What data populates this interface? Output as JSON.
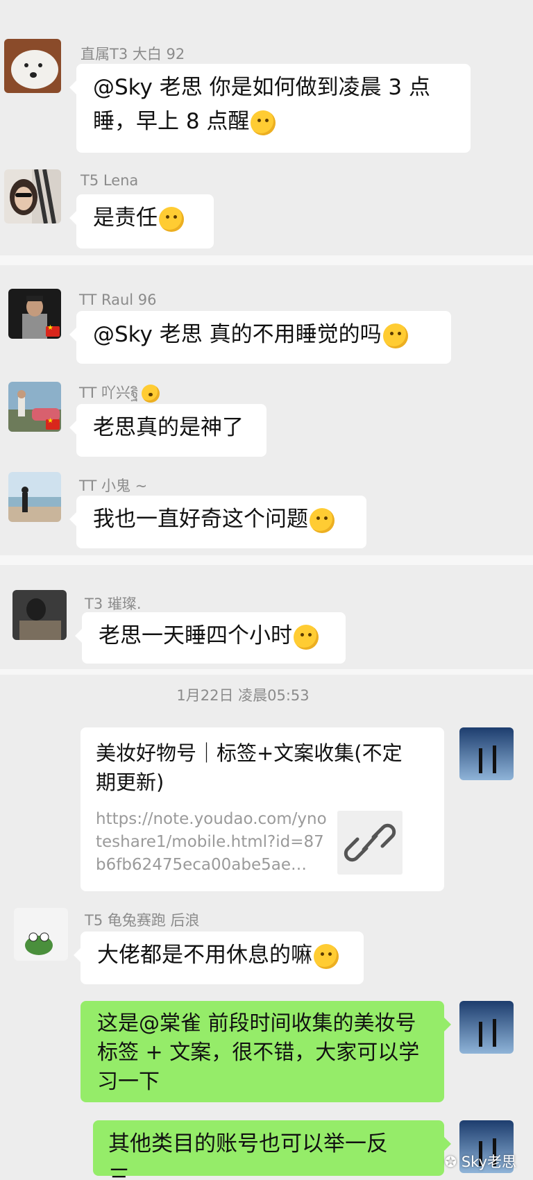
{
  "group1": {
    "msg1": {
      "sender": "直属T3 大白 92",
      "line1": "@Sky 老思  你是如何做到凌晨 3 点",
      "line2": "睡，早上 8 点醒",
      "emoji": "laughing-tears-emoji"
    },
    "msg2": {
      "sender": "T5 Lena",
      "text": "是责任",
      "emoji": "grinning-emoji"
    }
  },
  "group2": {
    "msg1": {
      "sender": "TT Raul 96",
      "text": "@Sky 老思  真的不用睡觉的吗",
      "emoji": "thinking-666-emoji"
    },
    "msg2": {
      "sender": "TT 吖兴ฐิ",
      "text": "老思真的是神了",
      "emoji": "relieved-emoji"
    },
    "msg3": {
      "sender": "TT 小鬼 ~",
      "text": "我也一直好奇这个问题",
      "emoji": "crying-emoji"
    }
  },
  "group3": {
    "msg1": {
      "sender": "T3 璀璨.",
      "text": "老思一天睡四个小时",
      "emoji": "dizzy-emoji"
    }
  },
  "group4": {
    "timestamp": "1月22日 凌晨05:53",
    "link_card": {
      "title": "美妆好物号｜标签+文案收集(不定期更新)",
      "url": "https://note.youdao.com/ynoteshare1/mobile.html?id=87b6fb62475eca00abe5ae…",
      "icon": "link-icon"
    },
    "msg2": {
      "sender": "T5 龟兔赛跑 后浪",
      "text": "大佬都是不用休息的嘛",
      "emoji": "thumbs-up-emoji"
    },
    "msg3": {
      "line1": "这是@棠雀  前段时间收集的美妆号",
      "line2": "标签 + 文案，很不错，大家可以学",
      "line3": "习一下"
    },
    "msg4": {
      "text": "其他类目的账号也可以举一反三、"
    }
  },
  "watermark": "Sky老思",
  "colors": {
    "chat_bg": "#ededed",
    "bubble_in": "#ffffff",
    "bubble_out_green": "#95ec69",
    "meta_text": "#8b8b8b"
  }
}
